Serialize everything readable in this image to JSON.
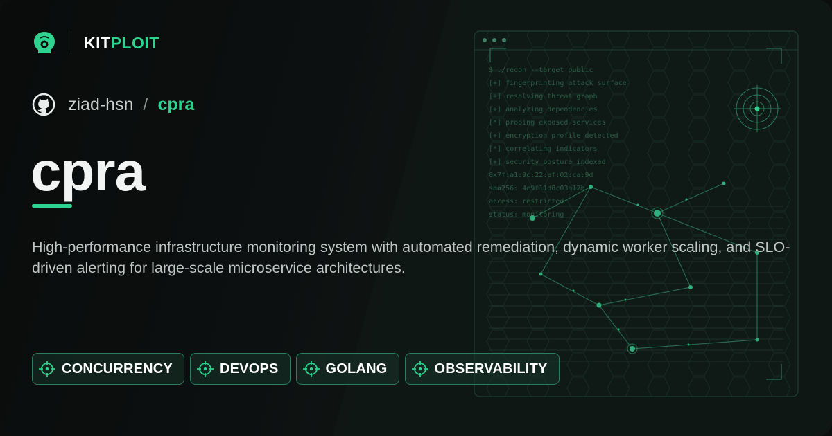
{
  "brand": {
    "name_part1": "KIT",
    "name_part2": "PLOIT"
  },
  "repo": {
    "owner": "ziad-hsn",
    "separator": "/",
    "name": "cpra"
  },
  "title": "cpra",
  "description": "High-performance infrastructure monitoring system with automated remediation, dynamic worker scaling, and SLO-driven alerting for large-scale microservice architectures.",
  "tags": [
    "CONCURRENCY",
    "DEVOPS",
    "GOLANG",
    "OBSERVABILITY"
  ],
  "terminal_lines": [
    "$ ./recon --target public",
    "[+] fingerprinting attack surface",
    "[+] resolving threat graph",
    "[+] analyzing dependencies",
    "[*] probing exposed services",
    "[+] encryption profile detected",
    "[*] correlating indicators",
    "[+] security posture indexed",
    "0x7f:a1:9c:22:ef:02:ca:9d",
    "sha256: 4e9f11d8c03a12b",
    "access: restricted",
    "status: monitoring"
  ],
  "colors": {
    "accent": "#2fd28f",
    "background": "#0b0e0d",
    "text": "#f2f4f3"
  }
}
